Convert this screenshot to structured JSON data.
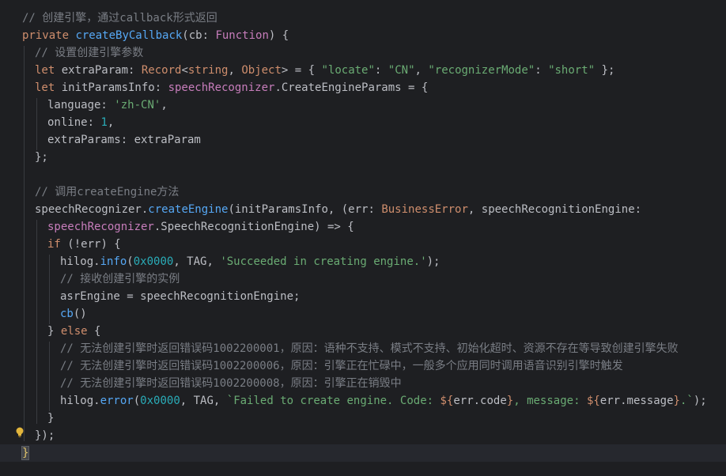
{
  "colors": {
    "background": "#1e1f22",
    "keyword": "#cf8e6d",
    "function": "#56a8f5",
    "type": "#c77dbb",
    "string": "#6aab73",
    "number": "#2aacb8",
    "comment": "#7a7e85",
    "text": "#bcbec4"
  },
  "icons": {
    "gutter": "lightbulb-icon"
  },
  "lines": [
    [
      [
        "cm",
        "// 创建引擎，通过callback形式返回"
      ]
    ],
    [
      [
        "kw",
        "private "
      ],
      [
        "fn",
        "createByCallback"
      ],
      [
        "txt",
        "(cb: "
      ],
      [
        "ty",
        "Function"
      ],
      [
        "txt",
        ") {"
      ]
    ],
    [
      [
        "cm",
        "// 设置创建引擎参数"
      ]
    ],
    [
      [
        "kw",
        "let "
      ],
      [
        "txt",
        "extraParam: "
      ],
      [
        "kw",
        "Record"
      ],
      [
        "txt",
        "<"
      ],
      [
        "kw",
        "string"
      ],
      [
        "txt",
        ", "
      ],
      [
        "kw",
        "Object"
      ],
      [
        "txt",
        "> = { "
      ],
      [
        "str",
        "\"locate\""
      ],
      [
        "txt",
        ": "
      ],
      [
        "str",
        "\"CN\""
      ],
      [
        "txt",
        ", "
      ],
      [
        "str",
        "\"recognizerMode\""
      ],
      [
        "txt",
        ": "
      ],
      [
        "str",
        "\"short\""
      ],
      [
        "txt",
        " };"
      ]
    ],
    [
      [
        "kw",
        "let "
      ],
      [
        "txt",
        "initParamsInfo: "
      ],
      [
        "ns",
        "speechRecognizer"
      ],
      [
        "txt",
        ".CreateEngineParams = {"
      ]
    ],
    [
      [
        "txt",
        "language: "
      ],
      [
        "str",
        "'zh-CN'"
      ],
      [
        "txt",
        ","
      ]
    ],
    [
      [
        "txt",
        "online: "
      ],
      [
        "num",
        "1"
      ],
      [
        "txt",
        ","
      ]
    ],
    [
      [
        "txt",
        "extraParams: extraParam"
      ]
    ],
    [
      [
        "txt",
        "};"
      ]
    ],
    [],
    [
      [
        "cm",
        "// 调用createEngine方法"
      ]
    ],
    [
      [
        "txt",
        "speechRecognizer."
      ],
      [
        "fn",
        "createEngine"
      ],
      [
        "txt",
        "(initParamsInfo, (err: "
      ],
      [
        "kw",
        "BusinessError"
      ],
      [
        "txt",
        ", speechRecognitionEngine:"
      ]
    ],
    [
      [
        "ns",
        "speechRecognizer"
      ],
      [
        "txt",
        ".SpeechRecognitionEngine) => {"
      ]
    ],
    [
      [
        "kw",
        "if "
      ],
      [
        "txt",
        "(!err) {"
      ]
    ],
    [
      [
        "txt",
        "hilog."
      ],
      [
        "fn",
        "info"
      ],
      [
        "txt",
        "("
      ],
      [
        "num",
        "0x0000"
      ],
      [
        "txt",
        ", TAG, "
      ],
      [
        "str",
        "'Succeeded in creating engine.'"
      ],
      [
        "txt",
        ");"
      ]
    ],
    [
      [
        "cm",
        "// 接收创建引擎的实例"
      ]
    ],
    [
      [
        "txt",
        "asrEngine = speechRecognitionEngine;"
      ]
    ],
    [
      [
        "fn",
        "cb"
      ],
      [
        "txt",
        "()"
      ]
    ],
    [
      [
        "txt",
        "} "
      ],
      [
        "kw",
        "else "
      ],
      [
        "txt",
        "{"
      ]
    ],
    [
      [
        "cm",
        "// 无法创建引擎时返回错误码1002200001，原因：语种不支持、模式不支持、初始化超时、资源不存在等导致创建引擎失败"
      ]
    ],
    [
      [
        "cm",
        "// 无法创建引擎时返回错误码1002200006，原因：引擎正在忙碌中，一般多个应用同时调用语音识别引擎时触发"
      ]
    ],
    [
      [
        "cm",
        "// 无法创建引擎时返回错误码1002200008，原因：引擎正在销毁中"
      ]
    ],
    [
      [
        "txt",
        "hilog."
      ],
      [
        "fn",
        "error"
      ],
      [
        "txt",
        "("
      ],
      [
        "num",
        "0x0000"
      ],
      [
        "txt",
        ", TAG, "
      ],
      [
        "str",
        "`Failed to create engine. Code: "
      ],
      [
        "tmpl",
        "${"
      ],
      [
        "txt",
        "err.code"
      ],
      [
        "tmpl",
        "}"
      ],
      [
        "str",
        ", message: "
      ],
      [
        "tmpl",
        "${"
      ],
      [
        "txt",
        "err.message"
      ],
      [
        "tmpl",
        "}"
      ],
      [
        "str",
        ".`"
      ],
      [
        "txt",
        ");"
      ]
    ],
    [
      [
        "txt",
        "}"
      ]
    ],
    [
      [
        "txt",
        "});"
      ]
    ],
    [
      [
        "txt",
        "}"
      ]
    ]
  ]
}
